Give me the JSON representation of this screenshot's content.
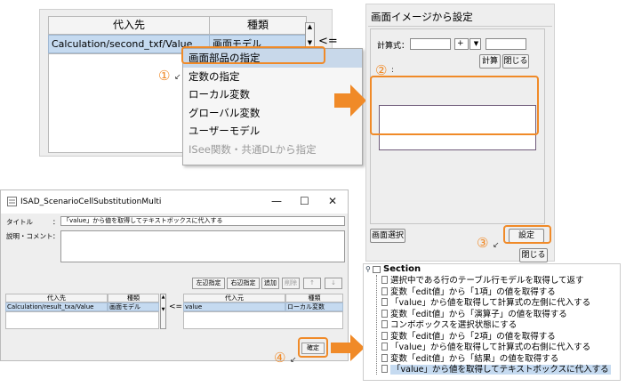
{
  "panel1": {
    "col_assign": "代入先",
    "col_type": "種類",
    "row_value": "Calculation/second_txf/Value",
    "row_type": "画面モデル",
    "side_arrow": "<=",
    "menu": [
      {
        "label": "画面部品の指定",
        "selected": true
      },
      {
        "label": "定数の指定"
      },
      {
        "label": "ローカル変数"
      },
      {
        "label": "グローバル変数"
      },
      {
        "label": "ユーザーモデル"
      },
      {
        "label": "ISee関数・共通DLから指定",
        "disabled": true
      }
    ]
  },
  "panel2": {
    "title": "画面イメージから設定",
    "formula_label": "計算式：",
    "operator": "+",
    "calc_button": "計算",
    "close_button": "閉じる",
    "screen_select_button": "画面選択",
    "set_button": "設定",
    "close_button2": "閉じる"
  },
  "markers": {
    "m1": "①",
    "m2": "②",
    "m3": "③",
    "m4": "④"
  },
  "panel3": {
    "window_title": "ISAD_ScenarioCellSubstitutionMulti",
    "minimize": "—",
    "maximize": "☐",
    "close": "✕",
    "title_label": "タイトル",
    "colon": "：",
    "title_value": "「value」から値を取得してテキストボックスに代入する",
    "comment_label": "説明・コメント",
    "buttons": [
      "左辺指定",
      "右辺指定",
      "追加",
      "削除",
      "↑",
      "↓"
    ],
    "left_headers": [
      "代入先",
      "種類"
    ],
    "left_row": [
      "Calculation/result_txa/Value",
      "画面モデル"
    ],
    "right_headers": [
      "代入元",
      "種類"
    ],
    "right_row": [
      "value",
      "ローカル変数"
    ],
    "side_arrow": "<=",
    "confirm_button": "確定"
  },
  "panel4": {
    "root": "Section",
    "items": [
      {
        "label": "選択中である行のテーブル行モデルを取得して返す"
      },
      {
        "label": "変数「edit値」から「1項」の値を取得する"
      },
      {
        "label": "「value」から値を取得して計算式の左側に代入する"
      },
      {
        "label": "変数「edit値」から「演算子」の値を取得する"
      },
      {
        "label": "コンボボックスを選択状態にする"
      },
      {
        "label": "変数「edit値」から「2項」の値を取得する"
      },
      {
        "label": "「value」から値を取得して計算式の右側に代入する"
      },
      {
        "label": "変数「edit値」から「結果」の値を取得する"
      },
      {
        "label": "「value」から値を取得してテキストボックスに代入する",
        "selected": true
      }
    ]
  },
  "colors": {
    "accent": "#f08a28",
    "selection": "#c5daf0"
  }
}
